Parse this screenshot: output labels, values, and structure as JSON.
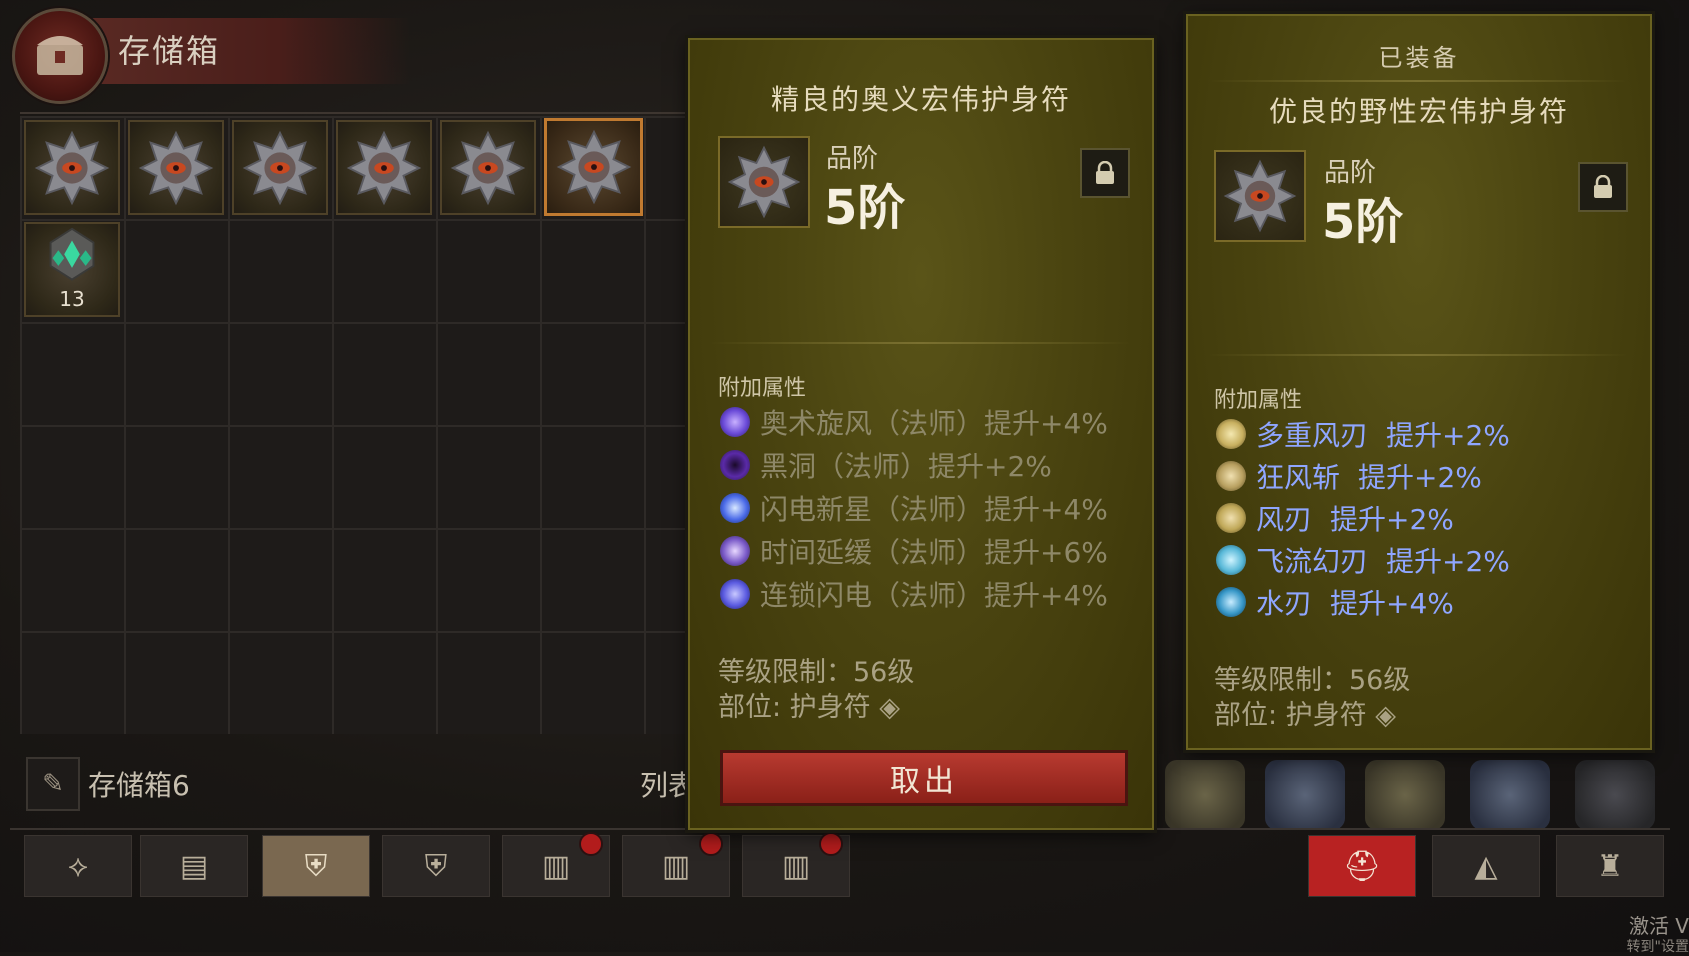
{
  "header": {
    "title": "存储箱",
    "chest_icon": "chest-icon"
  },
  "storage": {
    "name": "存储箱6",
    "list_label": "列表",
    "edit_icon": "quill-icon",
    "gem_count": "13"
  },
  "tooltip_left": {
    "title": "精良的奥义宏伟护身符",
    "grade_label": "品阶",
    "grade_value": "5阶",
    "lock_icon": "lock-icon",
    "attr_header": "附加属性",
    "affixes": [
      {
        "name": "奥术旋风",
        "class": "（法师）",
        "bonus": "提升+4%",
        "icon_color": "#6a4ad8"
      },
      {
        "name": "黑洞",
        "class": "（法师）",
        "bonus": "提升+2%",
        "icon_color": "#5a2aa8"
      },
      {
        "name": "闪电新星",
        "class": "（法师）",
        "bonus": "提升+4%",
        "icon_color": "#4a6ae8"
      },
      {
        "name": "时间延缓",
        "class": "（法师）",
        "bonus": "提升+6%",
        "icon_color": "#7a5ac8"
      },
      {
        "name": "连锁闪电",
        "class": "（法师）",
        "bonus": "提升+4%",
        "icon_color": "#5a5ae0"
      }
    ],
    "level_req": "等级限制：56级",
    "slot": "部位: 护身符",
    "take_button": "取出"
  },
  "tooltip_right": {
    "equipped_label": "已装备",
    "title": "优良的野性宏伟护身符",
    "grade_label": "品阶",
    "grade_value": "5阶",
    "lock_icon": "lock-icon",
    "attr_header": "附加属性",
    "affixes": [
      {
        "text": "多重风刃",
        "bonus": "提升+2%",
        "icon_color": "#c8b060"
      },
      {
        "text": "狂风斩",
        "bonus": "提升+2%",
        "icon_color": "#b8a060"
      },
      {
        "text": "风刃",
        "bonus": "提升+2%",
        "icon_color": "#c0a858"
      },
      {
        "text": "飞流幻刃",
        "bonus": "提升+2%",
        "icon_color": "#58b8d8"
      },
      {
        "text": "水刃",
        "bonus": "提升+4%",
        "icon_color": "#3898c8"
      }
    ],
    "level_req": "等级限制：56级",
    "slot": "部位: 护身符"
  },
  "bottom_tabs": [
    {
      "icon": "amulet-tab-icon"
    },
    {
      "icon": "chest-tab-icon"
    },
    {
      "icon": "chest-armor-tab-icon"
    },
    {
      "icon": "armor-tab-icon"
    },
    {
      "icon": "locked-chest-tab-icon"
    },
    {
      "icon": "locked-chest-tab-icon"
    },
    {
      "icon": "locked-chest-tab-icon"
    },
    {
      "icon": "helmet-tab-icon"
    },
    {
      "icon": "material-tab-icon"
    },
    {
      "icon": "bag-tab-icon"
    }
  ],
  "watermark": {
    "line1": "激活 V",
    "line2": "转到\"设置"
  },
  "colors": {
    "accent_red": "#b82222",
    "selected_border": "#c07a30",
    "affix_blue": "#8fa6ff"
  }
}
